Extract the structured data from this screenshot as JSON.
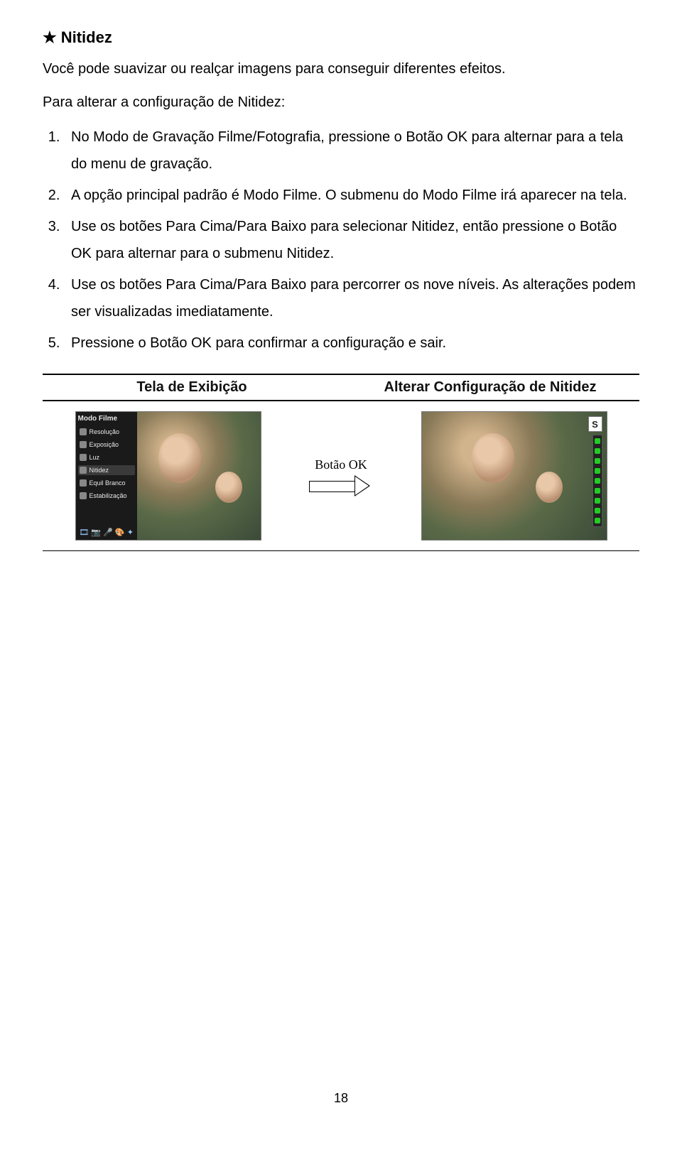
{
  "title": "Nitidez",
  "intro": "Você pode suavizar ou realçar imagens para conseguir diferentes efeitos.",
  "lead": "Para alterar a configuração de Nitidez:",
  "steps": [
    "No Modo de Gravação Filme/Fotografia, pressione o Botão OK para alternar para a tela do menu de gravação.",
    "A opção principal padrão é Modo Filme. O submenu do Modo Filme irá aparecer na tela.",
    "Use os botões Para Cima/Para Baixo para selecionar Nitidez, então pressione o Botão OK para alternar para o submenu Nitidez.",
    "Use os botões Para Cima/Para Baixo para percorrer os nove níveis. As alterações podem ser visualizadas imediatamente.",
    "Pressione o Botão OK para confirmar a configuração e sair."
  ],
  "table": {
    "col1": "Tela de Exibição",
    "col2": "Alterar Configuração de Nitidez"
  },
  "menu": {
    "title": "Modo Filme",
    "items": [
      "Resolução",
      "Exposição",
      "Luz",
      "Nitidez",
      "Equil Branco",
      "Estabilização"
    ],
    "active_index": 3
  },
  "arrow_label": "Botão OK",
  "badge": "S",
  "page_number": "18"
}
